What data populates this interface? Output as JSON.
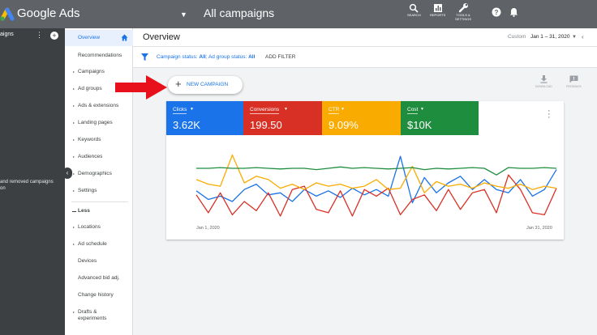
{
  "header": {
    "brand": "Google Ads",
    "page_title": "All campaigns",
    "tools": [
      {
        "icon": "search-icon",
        "label": "SEARCH"
      },
      {
        "icon": "reports-icon",
        "label": "REPORTS"
      },
      {
        "icon": "wrench-icon",
        "label_line1": "TOOLS &",
        "label_line2": "SETTINGS"
      }
    ]
  },
  "left_panel": {
    "heading": "aigns",
    "note_line1": "and removed campaigns",
    "note_line2": "on"
  },
  "nav": {
    "items": [
      {
        "label": "Overview"
      },
      {
        "label": "Recommendations"
      },
      {
        "label": "Campaigns"
      },
      {
        "label": "Ad groups"
      },
      {
        "label": "Ads & extensions"
      },
      {
        "label": "Landing pages"
      },
      {
        "label": "Keywords"
      },
      {
        "label": "Audiences"
      },
      {
        "label": "Demographics"
      },
      {
        "label": "Settings"
      }
    ],
    "less_label": "Less",
    "more_items": [
      {
        "label": "Locations"
      },
      {
        "label": "Ad schedule"
      },
      {
        "label": "Devices"
      },
      {
        "label": "Advanced bid adj."
      },
      {
        "label": "Change history"
      },
      {
        "label": "Drafts &",
        "label2": "experiments"
      }
    ]
  },
  "overview": {
    "title": "Overview",
    "custom_label": "Custom",
    "date_range": "Jan 1 – 31, 2020"
  },
  "filter": {
    "status_prefix": "Campaign status: ",
    "status_value": "All",
    "group_prefix": "; Ad group status: ",
    "group_value": "All",
    "add_filter": "ADD FILTER"
  },
  "new_campaign": {
    "label": "NEW CAMPAIGN"
  },
  "side_tools": {
    "download": "DOWNLOAD",
    "feedback": "FEEDBACK"
  },
  "metrics": [
    {
      "label": "Clicks",
      "value": "3.62K",
      "color": "#1a73e8"
    },
    {
      "label": "Conversions",
      "value": "199.50",
      "color": "#d93025"
    },
    {
      "label": "CTR",
      "value": "9.09%",
      "color": "#f9ab00"
    },
    {
      "label": "Cost",
      "value": "$10K",
      "color": "#1e8e3e"
    }
  ],
  "chart_data": {
    "type": "line",
    "x_start_label": "Jan 1, 2020",
    "x_end_label": "Jan 31, 2020",
    "x": [
      1,
      2,
      3,
      4,
      5,
      6,
      7,
      8,
      9,
      10,
      11,
      12,
      13,
      14,
      15,
      16,
      17,
      18,
      19,
      20,
      21,
      22,
      23,
      24,
      25,
      26,
      27,
      28,
      29,
      30,
      31
    ],
    "series": [
      {
        "name": "Clicks",
        "color": "#1a73e8",
        "values": [
          0.38,
          0.25,
          0.3,
          0.22,
          0.4,
          0.48,
          0.32,
          0.35,
          0.22,
          0.4,
          0.3,
          0.38,
          0.28,
          0.42,
          0.32,
          0.4,
          0.3,
          0.9,
          0.2,
          0.58,
          0.35,
          0.5,
          0.6,
          0.4,
          0.55,
          0.4,
          0.35,
          0.55,
          0.3,
          0.4,
          0.7
        ]
      },
      {
        "name": "Conversions",
        "color": "#d93025",
        "values": [
          0.32,
          0.05,
          0.35,
          0.02,
          0.22,
          0.08,
          0.35,
          0.0,
          0.4,
          0.45,
          0.1,
          0.05,
          0.38,
          0.0,
          0.4,
          0.3,
          0.42,
          0.02,
          0.25,
          0.32,
          0.08,
          0.4,
          0.1,
          0.35,
          0.4,
          0.05,
          0.62,
          0.4,
          0.05,
          0.02,
          0.42
        ]
      },
      {
        "name": "CTR",
        "color": "#f9ab00",
        "values": [
          0.55,
          0.48,
          0.45,
          0.92,
          0.5,
          0.6,
          0.55,
          0.42,
          0.48,
          0.4,
          0.5,
          0.45,
          0.48,
          0.42,
          0.45,
          0.55,
          0.4,
          0.42,
          0.75,
          0.35,
          0.52,
          0.45,
          0.48,
          0.42,
          0.5,
          0.45,
          0.42,
          0.48,
          0.4,
          0.45,
          0.42
        ]
      },
      {
        "name": "Cost",
        "color": "#1e8e3e",
        "values": [
          0.72,
          0.72,
          0.73,
          0.72,
          0.72,
          0.73,
          0.72,
          0.71,
          0.72,
          0.72,
          0.7,
          0.72,
          0.74,
          0.72,
          0.73,
          0.72,
          0.71,
          0.72,
          0.73,
          0.7,
          0.72,
          0.71,
          0.72,
          0.73,
          0.72,
          0.62,
          0.73,
          0.72,
          0.72,
          0.73,
          0.72
        ]
      }
    ]
  }
}
